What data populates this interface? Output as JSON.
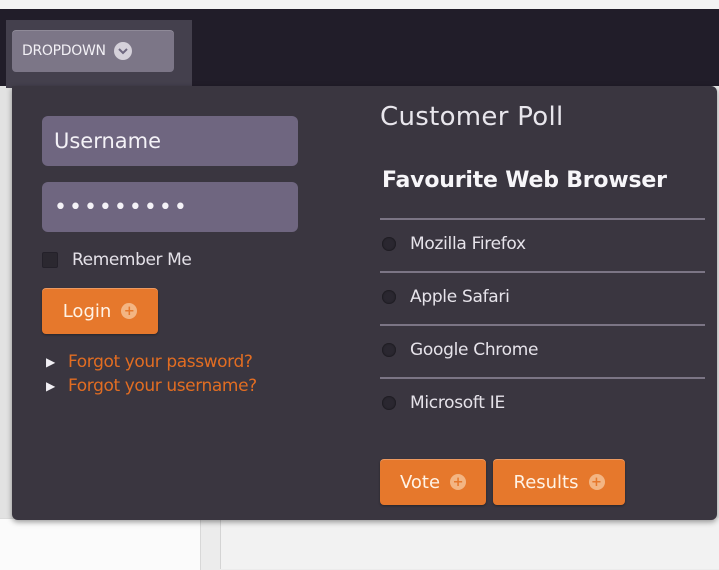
{
  "dropdown": {
    "label": "DROPDOWN",
    "icon": "chevron-down-icon"
  },
  "login": {
    "username_value": "Username",
    "password_value": "•••••••••",
    "remember_label": "Remember Me",
    "login_button": "Login",
    "links": [
      "Forgot your password?",
      "Forgot your username?"
    ]
  },
  "poll": {
    "title": "Customer Poll",
    "question": "Favourite Web Browser",
    "options": [
      "Mozilla Firefox",
      "Apple Safari",
      "Google Chrome",
      "Microsoft IE"
    ],
    "vote_button": "Vote",
    "results_button": "Results"
  },
  "colors": {
    "accent": "#e6782c",
    "panel": "#3a3640",
    "field": "#6f6680",
    "link": "#e26d22"
  }
}
